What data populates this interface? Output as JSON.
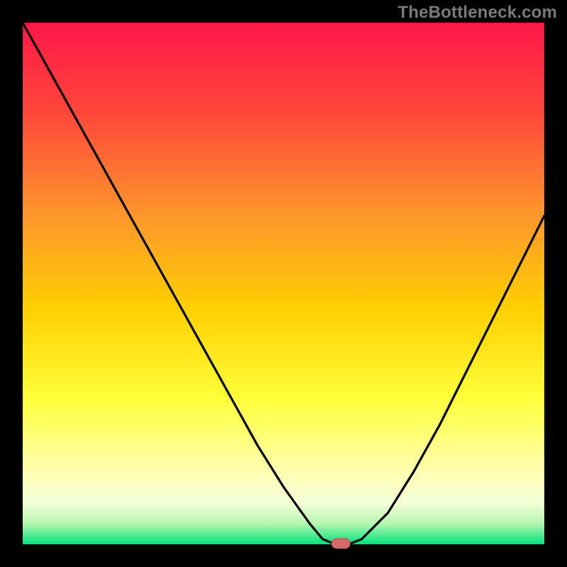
{
  "watermark": "TheBottleneck.com",
  "colors": {
    "frame": "#000000",
    "gradient_top": "#ff1648",
    "gradient_mid1": "#ff7a2a",
    "gradient_mid2": "#ffd000",
    "gradient_mid3": "#ffff3a",
    "gradient_pale": "#ffffd0",
    "gradient_green": "#00e27a",
    "curve": "#000000",
    "marker_fill": "#d46a6a",
    "marker_stroke": "#b04c4c"
  },
  "chart_data": {
    "type": "line",
    "title": "",
    "xlabel": "",
    "ylabel": "",
    "x": [
      0.0,
      0.05,
      0.1,
      0.15,
      0.2,
      0.25,
      0.3,
      0.35,
      0.4,
      0.45,
      0.5,
      0.55,
      0.575,
      0.6,
      0.625,
      0.65,
      0.7,
      0.75,
      0.8,
      0.85,
      0.9,
      0.95,
      1.0
    ],
    "values": [
      100,
      91,
      82,
      73,
      64,
      55,
      46,
      37,
      28,
      19,
      11,
      4,
      1,
      0,
      0,
      1,
      6,
      14,
      23,
      33,
      43,
      53,
      63
    ],
    "xlim": [
      0,
      1
    ],
    "ylim": [
      0,
      100
    ],
    "marker": {
      "x": 0.61,
      "y": 0
    },
    "notes": "V-shaped bottleneck curve over red→yellow→green vertical gradient; minimum near x≈0.61"
  }
}
